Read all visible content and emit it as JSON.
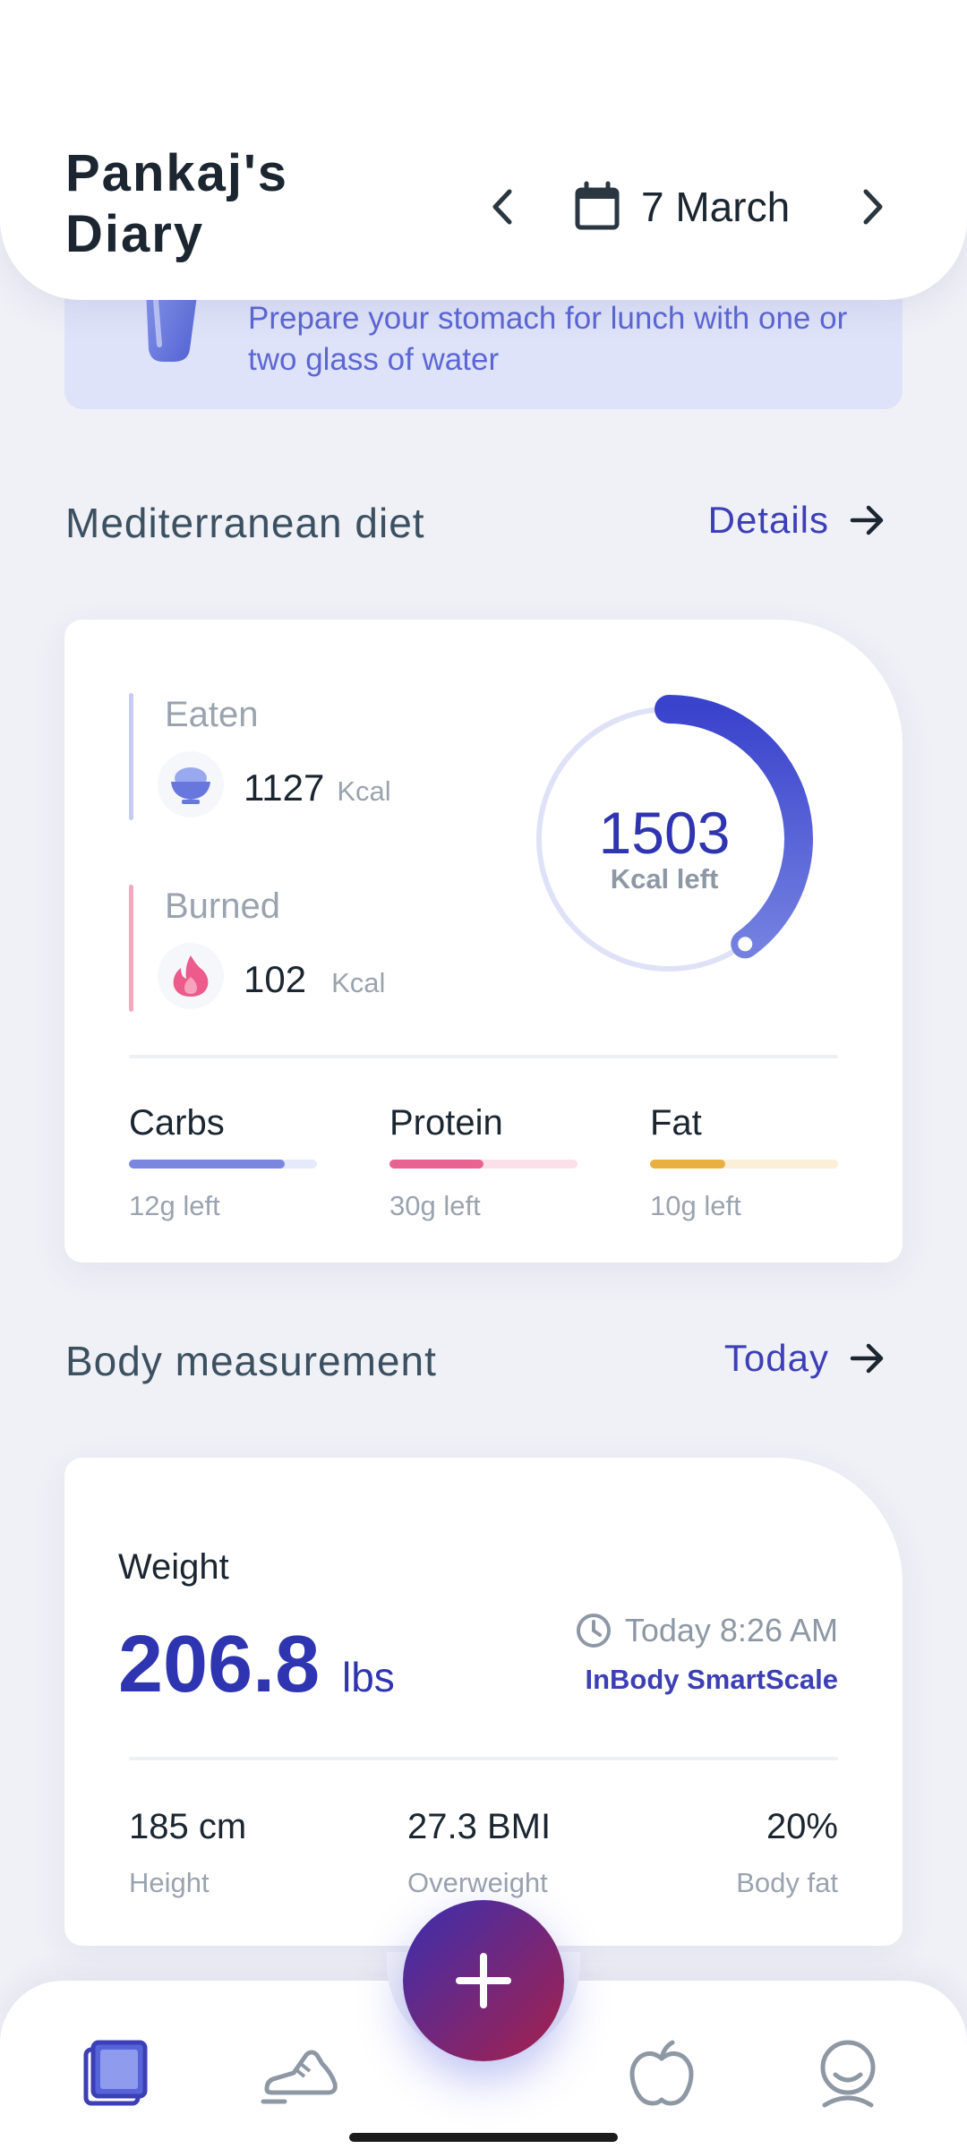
{
  "header": {
    "title": "Pankaj's Diary",
    "date": "7 March"
  },
  "tip": {
    "text": "Prepare your stomach for lunch with one or two glass of water"
  },
  "diet_section": {
    "title": "Mediterranean diet",
    "link": "Details"
  },
  "diet_card": {
    "eaten_label": "Eaten",
    "eaten_value": "1127",
    "eaten_unit": "Kcal",
    "burned_label": "Burned",
    "burned_value": "102",
    "burned_unit": "Kcal",
    "kcal_left_value": "1503",
    "kcal_left_label": "Kcal left",
    "ring_progress": 0.4,
    "macros": [
      {
        "name": "Carbs",
        "left": "12g left",
        "progress": 0.83,
        "color": "#7b87de",
        "track": "#e6e9fa"
      },
      {
        "name": "Protein",
        "left": "30g left",
        "progress": 0.5,
        "color": "#e8638f",
        "track": "#fbe0ea"
      },
      {
        "name": "Fat",
        "left": "10g left",
        "progress": 0.4,
        "color": "#e7b040",
        "track": "#fcefd8"
      }
    ]
  },
  "body_section": {
    "title": "Body measurement",
    "link": "Today"
  },
  "body_card": {
    "weight_label": "Weight",
    "weight_value": "206.8",
    "weight_unit": "lbs",
    "time": "Today 8:26 AM",
    "device": "InBody SmartScale",
    "height_value": "185 cm",
    "height_label": "Height",
    "bmi_value": "27.3 BMI",
    "bmi_label": "Overweight",
    "fat_value": "20%",
    "fat_label": "Body fat"
  },
  "colors": {
    "accent": "#2f35b0",
    "eaten_bar": "#c7cbf2",
    "burned_bar": "#f4a8c0"
  },
  "nav": {
    "items": [
      "diary-icon",
      "activity-shoe-icon",
      "add-icon",
      "nutrition-apple-icon",
      "profile-icon"
    ]
  }
}
